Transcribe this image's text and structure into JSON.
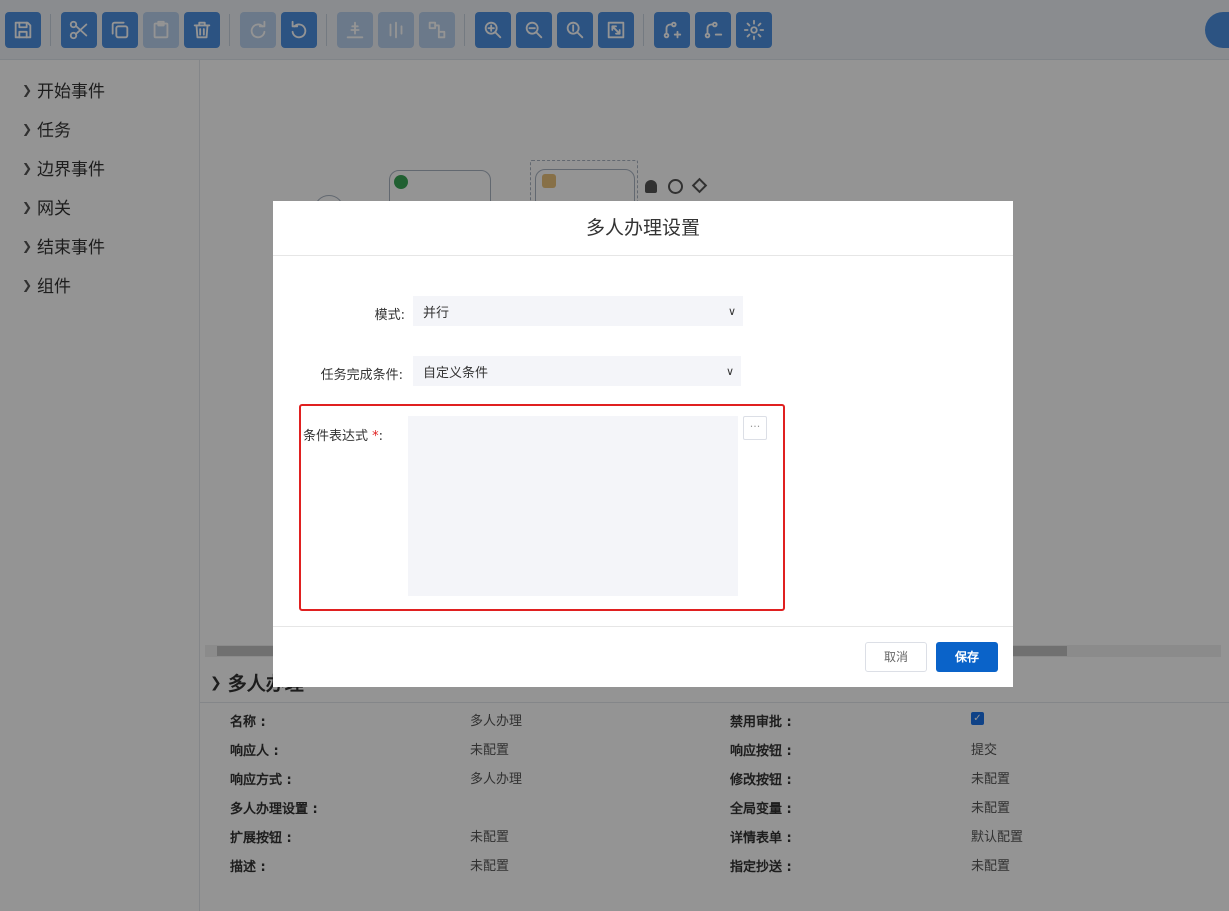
{
  "sidebar": {
    "items": [
      {
        "label": "开始事件"
      },
      {
        "label": "任务"
      },
      {
        "label": "边界事件"
      },
      {
        "label": "网关"
      },
      {
        "label": "结束事件"
      },
      {
        "label": "组件"
      }
    ]
  },
  "properties": {
    "header": "多人办理",
    "left": [
      {
        "label": "名称 :",
        "value": "多人办理"
      },
      {
        "label": "响应人 :",
        "value": "未配置"
      },
      {
        "label": "响应方式 :",
        "value": "多人办理"
      },
      {
        "label": "多人办理设置 :",
        "value": ""
      },
      {
        "label": "扩展按钮 :",
        "value": "未配置"
      },
      {
        "label": "描述 :",
        "value": "未配置"
      }
    ],
    "right": [
      {
        "label": "禁用审批 :",
        "value": ""
      },
      {
        "label": "响应按钮 :",
        "value": "提交"
      },
      {
        "label": "修改按钮 :",
        "value": "未配置"
      },
      {
        "label": "全局变量 :",
        "value": "未配置"
      },
      {
        "label": "详情表单 :",
        "value": "默认配置"
      },
      {
        "label": "指定抄送 :",
        "value": "未配置"
      }
    ],
    "disable_approval_checked": true
  },
  "dialog": {
    "title": "多人办理设置",
    "mode_label": "模式:",
    "mode_value": "并行",
    "condition_label": "任务完成条件:",
    "condition_value": "自定义条件",
    "expression_label": "条件表达式",
    "expression_required": "*",
    "expression_colon": ":",
    "expression_value": "",
    "more_button": "···",
    "cancel_label": "取消",
    "save_label": "保存"
  },
  "colors": {
    "toolbar_button": "#4d8fe0",
    "primary_button": "#0a63c9",
    "highlight_border": "#e02020"
  }
}
